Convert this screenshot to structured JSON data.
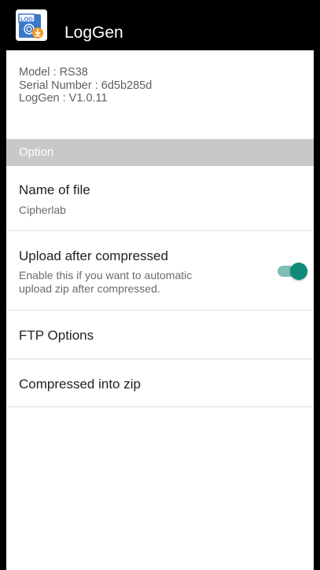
{
  "app": {
    "title": "LogGen",
    "icon_text": "LOG"
  },
  "device_info": {
    "model": "Model : RS38",
    "serial": "Serial Number : 6d5b285d",
    "version": "LogGen : V1.0.11"
  },
  "section": {
    "label": "Option"
  },
  "prefs": {
    "file_name": {
      "title": "Name of file",
      "value": "Cipherlab"
    },
    "upload": {
      "title": "Upload after compressed",
      "summary_line1": "Enable this if you want to automatic",
      "summary_line2": "upload zip after compressed.",
      "enabled": true
    },
    "ftp": {
      "title": "FTP Options"
    },
    "zip": {
      "title": "Compressed into zip"
    }
  },
  "colors": {
    "accent": "#0f8a78",
    "section_bg": "#c8c8c8",
    "appbar_bg": "#000000"
  }
}
